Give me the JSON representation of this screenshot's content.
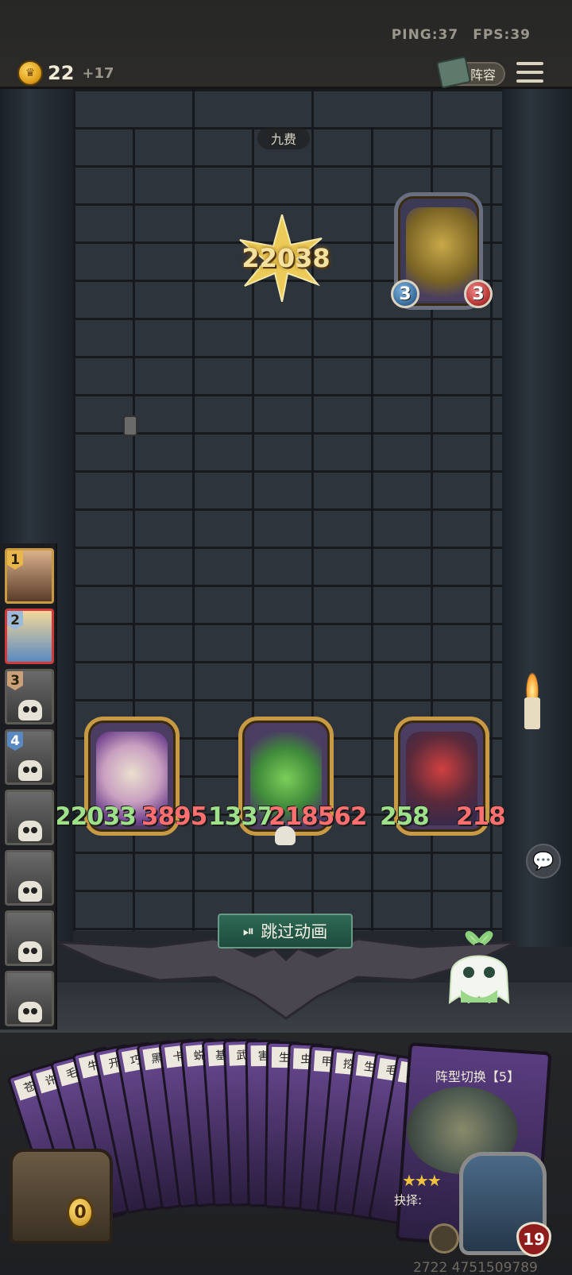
{
  "hud": {
    "ping": "PING:37",
    "fps": "FPS:39",
    "gold": "22",
    "gold_income": "+17",
    "lineup_label": "阵容"
  },
  "battle": {
    "round_label": "九费",
    "damage_number": "22038",
    "skip_label": "跳过动画"
  },
  "enemy": {
    "attack": "3",
    "health": "3"
  },
  "board": {
    "units": [
      {
        "name": "pelican",
        "attack": "22033",
        "health": "3895"
      },
      {
        "name": "caterpillar",
        "attack": "1337",
        "health": "218562"
      },
      {
        "name": "jester",
        "attack": "258",
        "health": "218"
      }
    ]
  },
  "roster": [
    {
      "rank": "1",
      "color": "#e8b64a"
    },
    {
      "rank": "2",
      "color": "#9bb9d8"
    },
    {
      "rank": "3",
      "color": "#c9a07a"
    },
    {
      "rank": "4",
      "color": "#5a88c0"
    }
  ],
  "hand": {
    "card_glyphs": [
      "苍",
      "许",
      "毛",
      "牛",
      "开",
      "巧",
      "黑",
      "卡",
      "蜕",
      "基",
      "武",
      "害",
      "生",
      "虫",
      "甲",
      "挖",
      "生",
      "毛",
      "齑"
    ],
    "featured_card_title": "阵型切换【5】",
    "featured_card_footer": "抉择:",
    "hero_health": "19",
    "chest_counter": "0"
  },
  "footer_number": "2722 4751509789"
}
